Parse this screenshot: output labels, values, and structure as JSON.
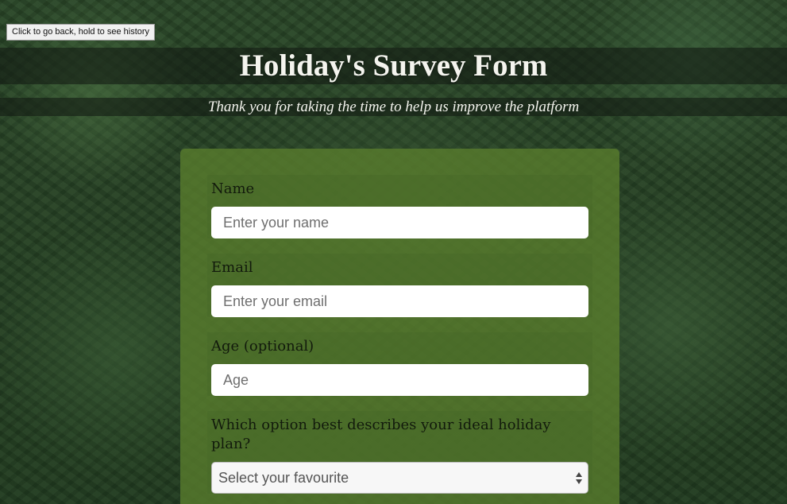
{
  "tooltip": "Click to go back, hold to see history",
  "header": {
    "title": "Holiday's Survey Form",
    "subtitle": "Thank you for taking the time to help us improve the platform"
  },
  "form": {
    "name": {
      "label": "Name",
      "placeholder": "Enter your name",
      "value": ""
    },
    "email": {
      "label": "Email",
      "placeholder": "Enter your email",
      "value": ""
    },
    "age": {
      "label": "Age (optional)",
      "placeholder": "Age",
      "value": ""
    },
    "holiday_plan": {
      "label": "Which option best describes your ideal holiday plan?",
      "selected": "Select your favourite"
    }
  },
  "colors": {
    "card": "#5a7d2d",
    "title_text": "#f4f4ee",
    "label_text": "#121a0c",
    "input_bg": "#ffffff"
  }
}
